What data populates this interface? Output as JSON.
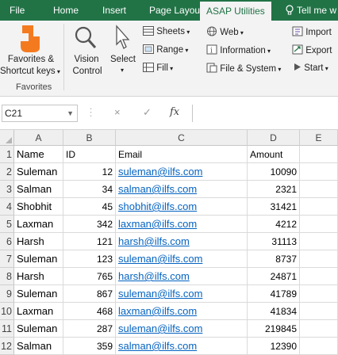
{
  "tabs": [
    {
      "label": "File",
      "active": false
    },
    {
      "label": "Home",
      "active": false
    },
    {
      "label": "Insert",
      "active": false
    },
    {
      "label": "Page Layou",
      "active": false
    },
    {
      "label": "ASAP Utilities",
      "active": true
    },
    {
      "label": "Tell me w",
      "active": false,
      "icon": "lightbulb-icon"
    }
  ],
  "ribbon": {
    "favorites_label_1": "Favorites &",
    "favorites_label_2": "Shortcut keys",
    "favorites_group": "Favorites",
    "vision_label_1": "Vision",
    "vision_label_2": "Control",
    "select_label": "Select",
    "sheets": "Sheets",
    "range": "Range",
    "fill": "Fill",
    "web": "Web",
    "information": "Information",
    "file_system": "File & System",
    "import": "Import",
    "export": "Export",
    "start": "Start"
  },
  "formula_bar": {
    "name_box": "C21",
    "cancel_symbol": "×",
    "enter_symbol": "✓",
    "fx_symbol": "fx",
    "formula": ""
  },
  "columns": [
    "A",
    "B",
    "C",
    "D",
    "E"
  ],
  "rows": [
    {
      "num": "1",
      "name": "Name",
      "id": "ID",
      "email": "Email",
      "amount": "Amount",
      "header": true
    },
    {
      "num": "2",
      "name": "Suleman",
      "id": "12",
      "email": "suleman@ilfs.com",
      "amount": "10090"
    },
    {
      "num": "3",
      "name": "Salman",
      "id": "34",
      "email": "salman@ilfs.com",
      "amount": "2321"
    },
    {
      "num": "4",
      "name": "Shobhit",
      "id": "45",
      "email": "shobhit@ilfs.com",
      "amount": "31421"
    },
    {
      "num": "5",
      "name": "Laxman",
      "id": "342",
      "email": "laxman@ilfs.com",
      "amount": "4212"
    },
    {
      "num": "6",
      "name": "Harsh",
      "id": "121",
      "email": "harsh@ilfs.com",
      "amount": "31113"
    },
    {
      "num": "7",
      "name": "Suleman",
      "id": "123",
      "email": "suleman@ilfs.com",
      "amount": "8737"
    },
    {
      "num": "8",
      "name": "Harsh",
      "id": "765",
      "email": "harsh@ilfs.com",
      "amount": "24871"
    },
    {
      "num": "9",
      "name": "Suleman",
      "id": "867",
      "email": "suleman@ilfs.com",
      "amount": "41789"
    },
    {
      "num": "10",
      "name": "Laxman",
      "id": "468",
      "email": "laxman@ilfs.com",
      "amount": "41834"
    },
    {
      "num": "11",
      "name": "Suleman",
      "id": "287",
      "email": "suleman@ilfs.com",
      "amount": "219845"
    },
    {
      "num": "12",
      "name": "Salman",
      "id": "359",
      "email": "salman@ilfs.com",
      "amount": "12390"
    }
  ],
  "colors": {
    "ribbon_green": "#217346",
    "link_blue": "#0563c1",
    "favorites_orange": "#f47a20"
  }
}
